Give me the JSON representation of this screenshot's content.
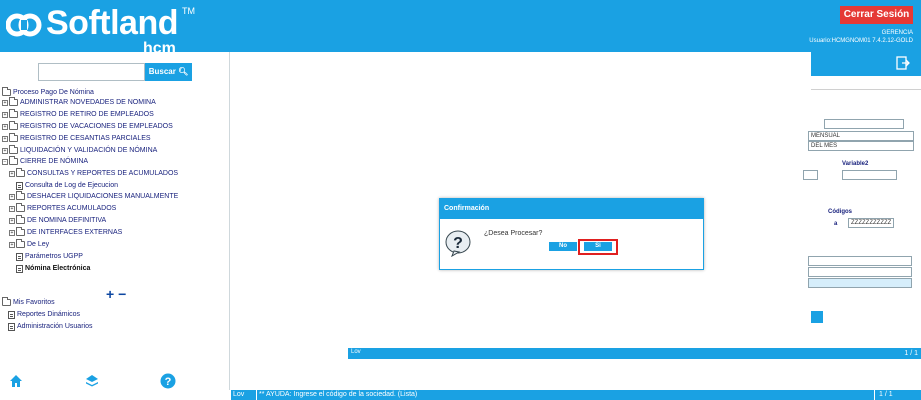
{
  "header": {
    "logo_text": "Softland",
    "logo_tm": "TM",
    "logo_sub": "hcm",
    "logout_label": "Cerrar Sesión",
    "role": "GERENCIA",
    "user_line": "Usuario:HCMGNOM01 7.4.2.12-GOLD"
  },
  "sidebar": {
    "search_placeholder": "",
    "search_label": "Buscar",
    "tree_root": "Proceso Pago De Nómina",
    "items": [
      "ADMINISTRAR NOVEDADES DE NOMINA",
      "REGISTRO DE RETIRO DE EMPLEADOS",
      "REGISTRO DE VACACIONES DE EMPLEADOS",
      "REGISTRO DE CESANTIAS PARCIALES",
      "LIQUIDACIÓN Y VALIDACIÓN DE NÓMINA",
      "CIERRE DE NÓMINA"
    ],
    "sub_items": [
      "CONSULTAS Y REPORTES DE ACUMULADOS",
      "Consulta de Log de Ejecucion",
      "DESHACER LIQUIDACIONES MANUALMENTE",
      "REPORTES ACUMULADOS",
      "DE NOMINA DEFINITIVA",
      "DE INTERFACES EXTERNAS",
      "De Ley",
      "Parámetros UGPP",
      "Nómina Electrónica"
    ],
    "favorites_root": "Mis Favoritos",
    "favorites": [
      "Reportes Dinámicos",
      "Administración Usuarios"
    ],
    "plus_minus": "+ −"
  },
  "panel": {
    "field_mensual": "MENSUAL",
    "field_mes": "DEL MES",
    "label_variable2": "Variable2",
    "label_codigos": "Códigos",
    "codigos_marker": "a",
    "codigos_value": "ZZZZZZZZZZZ",
    "lov": "Lov",
    "page": "1 / 1"
  },
  "dialog": {
    "title": "Confirmación",
    "question": "¿Desea Procesar?",
    "no_label": "No",
    "yes_label": "Si"
  },
  "statusbar": {
    "mode": "Lov",
    "help": "** AYUDA: Ingrese el código de la sociedad. (Lista)",
    "page": "1 / 1"
  },
  "colors": {
    "brand": "#1aa1e3",
    "logout": "#e53935",
    "highlight": "#e02020"
  }
}
